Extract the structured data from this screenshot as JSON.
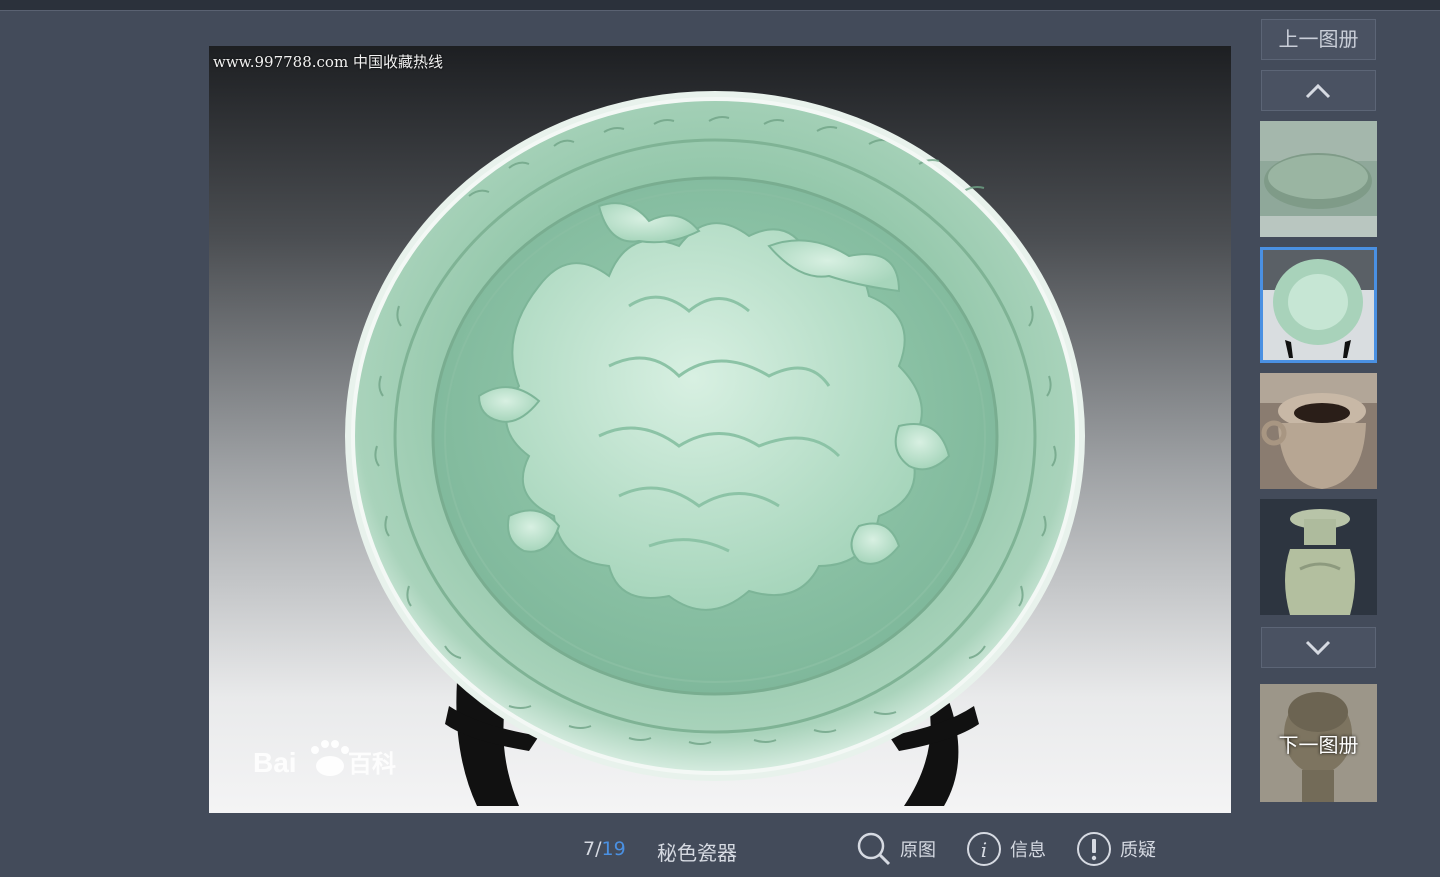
{
  "photo": {
    "watermark_site": "www.997788.com 中国收藏热线",
    "watermark_brand": "Bai百科"
  },
  "sidebar": {
    "prev_album_label": "上一图册",
    "next_album_label": "下一图册",
    "thumbnails": [
      "thumb-celadon-bowl",
      "thumb-celadon-plate",
      "thumb-pottery-jar",
      "thumb-celadon-vase"
    ],
    "active_index": 1
  },
  "footer": {
    "current": "7",
    "separator": "/",
    "total": "19",
    "album_title": "秘色瓷器",
    "tools": {
      "original_label": "原图",
      "info_label": "信息",
      "report_label": "质疑"
    }
  },
  "colors": {
    "background": "#434b5a",
    "accent": "#4a90e2",
    "celadon": "#9fcfb4"
  }
}
